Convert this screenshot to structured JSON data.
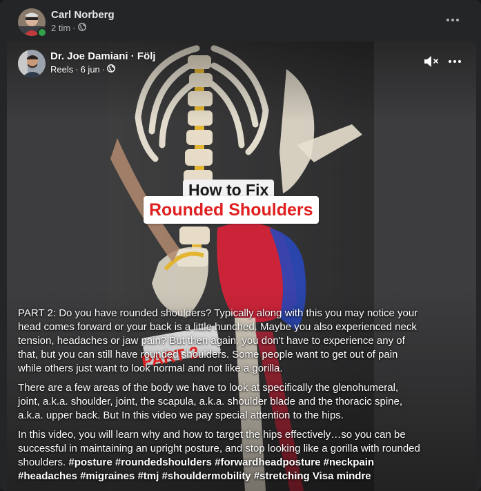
{
  "post": {
    "author": "Carl Norberg",
    "time": "2 tim",
    "separator": "·",
    "audience_icon": "globe-icon",
    "more_icon": "more-horizontal-icon"
  },
  "reel": {
    "author": "Dr. Joe Damiani",
    "follow": "Följ",
    "source": "Reels",
    "date": "6 jun",
    "audience_icon": "globe-icon",
    "mute_icon": "speaker-muted-icon",
    "more_icon": "more-horizontal-icon",
    "overlay_title_line1": "How to Fix",
    "overlay_title_line2": "Rounded Shoulders",
    "overlay_part": "PART 2",
    "caption": {
      "p1": "PART 2: Do you have rounded shoulders? Typically along with this you may notice your head comes forward or your back is a little hunched. Maybe you also experienced neck tension, headaches or jaw pain? But then again, you don't have to experience any of that, but you can still have rounded shoulders. Some people want to get out of pain while others just want to look normal and not like a gorilla.",
      "p2": "There are a few areas of the body we have to look at specifically the glenohumeral, joint, a.k.a. shoulder, joint, the scapula, a.k.a. shoulder blade and the thoracic spine, a.k.a. upper back. But In this video we pay special attention to the hips.",
      "p3": "In this video, you will learn why and how to target the hips effectively…so you can be successful in maintaining an upright posture, and stop looking like a gorilla with rounded shoulders.",
      "hashtags": [
        "#posture",
        "#roundedshoulders",
        "#forwardheadposture",
        "#neckpain",
        "#headaches",
        "#migraines",
        "#tmj",
        "#shouldermobility",
        "#stretching"
      ],
      "see_more": "Visa mindre"
    }
  },
  "colors": {
    "card_bg": "#242526",
    "text_primary": "#e4e6eb",
    "text_secondary": "#b0b3b8",
    "online": "#31a24c",
    "title_red": "#e02020"
  }
}
